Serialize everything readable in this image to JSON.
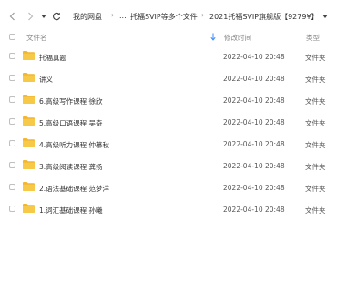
{
  "toolbar": {
    "back_icon": "chevron-left",
    "forward_icon": "chevron-right",
    "history_icon": "caret-down",
    "refresh_icon": "refresh",
    "breadcrumbs": [
      "我的网盘",
      "...",
      "托福SVIP等多个文件",
      "2021托福SVIP旗舰版【9279¥】"
    ],
    "more_icon": "caret-down"
  },
  "columns": {
    "name": "文件名",
    "modified": "修改时间",
    "type": "类型",
    "sort_icon": "arrow-down"
  },
  "files": [
    {
      "name": "托福真题",
      "modified": "2022-04-10 20:48",
      "type": "文件夹"
    },
    {
      "name": "讲义",
      "modified": "2022-04-10 20:48",
      "type": "文件夹"
    },
    {
      "name": "6.高级写作课程  徐欣",
      "modified": "2022-04-10 20:48",
      "type": "文件夹"
    },
    {
      "name": "5.高级口语课程  吴奇",
      "modified": "2022-04-10 20:48",
      "type": "文件夹"
    },
    {
      "name": "4.高级听力课程  仲慕秋",
      "modified": "2022-04-10 20:48",
      "type": "文件夹"
    },
    {
      "name": "3.高级阅读课程  龚扬",
      "modified": "2022-04-10 20:48",
      "type": "文件夹"
    },
    {
      "name": "2.语法基础课程  范梦洋",
      "modified": "2022-04-10 20:48",
      "type": "文件夹"
    },
    {
      "name": "1.词汇基础课程  孙曦",
      "modified": "2022-04-10 20:48",
      "type": "文件夹"
    }
  ],
  "colors": {
    "folder": "#f7c948",
    "folder_tab": "#f2b630",
    "sort_arrow": "#3b8cff"
  }
}
